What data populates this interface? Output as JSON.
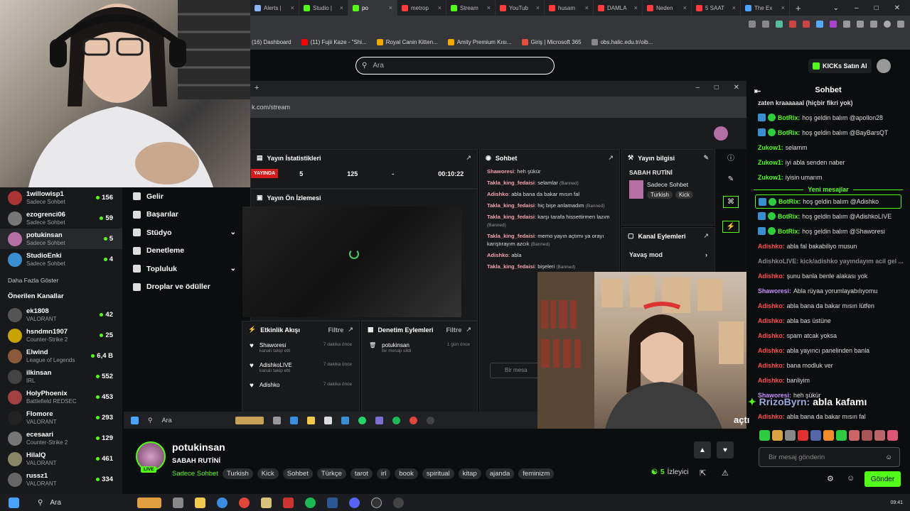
{
  "browser": {
    "tabs": [
      {
        "label": "Alerts | ",
        "color": "#8ab4f8"
      },
      {
        "label": "Studio | ",
        "color": "#53fc18"
      },
      {
        "label": "po",
        "color": "#53fc18",
        "active": true
      },
      {
        "label": "metrop",
        "color": "#ff3b3b"
      },
      {
        "label": "Stream",
        "color": "#53fc18"
      },
      {
        "label": "YouTub",
        "color": "#ff3b3b"
      },
      {
        "label": "husam",
        "color": "#ff3b3b"
      },
      {
        "label": "DAMLA",
        "color": "#ff3b3b"
      },
      {
        "label": "Neden",
        "color": "#ff3b3b"
      },
      {
        "label": "5 SAAT",
        "color": "#ff3b3b"
      },
      {
        "label": "The Ex",
        "color": "#4aa3ff"
      }
    ],
    "new_tab": "+",
    "bookmarks": [
      {
        "label": "(16) Dashboard",
        "color": "#444"
      },
      {
        "label": "(11) Fujii Kaze - \"Shi...",
        "color": "#ff0000"
      },
      {
        "label": "Royal Canin Kitten...",
        "color": "#f2a900"
      },
      {
        "label": "Amity Premium Kısı...",
        "color": "#f2a900"
      },
      {
        "label": "Giriş | Microsoft 365",
        "color": "#e74c3c"
      },
      {
        "label": "obs.halic.edu.tr/oib...",
        "color": "#888"
      }
    ]
  },
  "header": {
    "search_placeholder": "Ara",
    "kicks_button": "KICKs Satın Al"
  },
  "sidebar": {
    "followed": [
      {
        "name": "1willowisp1",
        "sub": "Sadece Sohbet",
        "viewers": "156",
        "color": "#a33"
      },
      {
        "name": "ezogrenci06",
        "sub": "Sadece Sohbet",
        "viewers": "59",
        "color": "#777"
      },
      {
        "name": "potukinsan",
        "sub": "Sadece Sohbet",
        "viewers": "5",
        "color": "#b56fa5"
      },
      {
        "name": "StudioEnki",
        "sub": "Sadece Sohbet",
        "viewers": "4",
        "color": "#3a8fd0"
      }
    ],
    "show_more": "Daha Fazla Göster",
    "recommended_title": "Önerilen Kanallar",
    "recommended": [
      {
        "name": "ek1808",
        "sub": "VALORANT",
        "viewers": "42",
        "color": "#555"
      },
      {
        "name": "hsndmn1907",
        "sub": "Counter-Strike 2",
        "viewers": "25",
        "color": "#c9a400"
      },
      {
        "name": "Elwind",
        "sub": "League of Legends",
        "viewers": "6,4 B",
        "color": "#8a5a3a"
      },
      {
        "name": "ilkinsan",
        "sub": "IRL",
        "viewers": "552",
        "color": "#444"
      },
      {
        "name": "HolyPhoenix",
        "sub": "Battlefield REDSEC",
        "viewers": "453",
        "color": "#a04040"
      },
      {
        "name": "Flomore",
        "sub": "VALORANT",
        "viewers": "293",
        "color": "#222"
      },
      {
        "name": "ecesaari",
        "sub": "Counter-Strike 2",
        "viewers": "129",
        "color": "#777"
      },
      {
        "name": "HilalQ",
        "sub": "VALORANT",
        "viewers": "461",
        "color": "#886"
      },
      {
        "name": "russz1",
        "sub": "VALORANT",
        "viewers": "334",
        "color": "#666"
      }
    ]
  },
  "nav": {
    "items": [
      "Gelir",
      "Başarılar",
      "Stüdyo",
      "Denetleme",
      "Topluluk",
      "Droplar ve ödüller"
    ]
  },
  "share": {
    "url": "k.com/stream",
    "stats_title": "Yayın İstatistikleri",
    "live_label": "YAYINDA",
    "stat1": "5",
    "stat2": "125",
    "stat3": "-",
    "stat4": "00:10:22",
    "preview_title": "Yayın Ön İzlemesi",
    "chat_title": "Sohbet",
    "chat_lines": [
      {
        "user": "Shaworesi",
        "text": "heh şükür",
        "note": ""
      },
      {
        "user": "Takla_king_fedaisi",
        "text": "selamlar",
        "note": "(Banned)"
      },
      {
        "user": "Adishko",
        "text": "abla bana da bakar mısın fal",
        "note": ""
      },
      {
        "user": "Takla_king_fedaisi",
        "text": "hiç bişe anlamadım",
        "note": "(Banned)"
      },
      {
        "user": "Takla_king_fedaisi",
        "text": "karşı tarafa hissettirmen lazım",
        "note": "(Banned)"
      },
      {
        "user": "Takla_king_fedaisi",
        "text": "memo yayın açtımı ya orayı karıştırayım azcık",
        "note": "(Banned)"
      },
      {
        "user": "Adishko",
        "text": "abla",
        "note": ""
      },
      {
        "user": "Takla_king_fedaisi",
        "text": "bişeleri",
        "note": "(Banned)"
      }
    ],
    "info_title": "Yayın bilgisi",
    "info_stream_title": "SABAH RUTİNİ",
    "info_category": "Sadece Sohbet",
    "info_tags": [
      "Turkish",
      "Kick"
    ],
    "channel_actions_title": "Kanal Eylemleri",
    "slow_mode": "Yavaş mod",
    "activity_title": "Etkinlik Akışı",
    "filter": "Filtre",
    "events": [
      {
        "user": "Shaworesi",
        "action": "kanalı takip etti",
        "time": "7 dakika önce"
      },
      {
        "user": "AdishkoLIVE",
        "action": "kanalı takip etti",
        "time": "7 dakika önce"
      },
      {
        "user": "Adishko",
        "action": "",
        "time": "7 dakika önce"
      }
    ],
    "mod_title": "Denetim Eylemleri",
    "mod_event": {
      "user": "potukinsan",
      "action": "bir mesajı sildi",
      "time": "1 gün önce"
    },
    "mini_input": "Bir mesa",
    "taskbar_search": "Ara"
  },
  "chat": {
    "title": "Sohbet",
    "messages": [
      {
        "user": "zaten kraaaaaal (hiçbir fikri yok)",
        "text": "",
        "color": "#ddd",
        "bot": false,
        "hl": false
      },
      {
        "user": "BotRix:",
        "text": "hoş geldin balım @apollon28",
        "color": "#53fc18",
        "bot": true,
        "hl": false
      },
      {
        "user": "BotRix:",
        "text": "hoş geldin balım @BayBarsQT",
        "color": "#53fc18",
        "bot": true,
        "hl": false
      },
      {
        "user": "Zukow1:",
        "text": "selamm",
        "color": "#53fc18",
        "bot": false,
        "hl": false
      },
      {
        "user": "Zukow1:",
        "text": "iyi abla senden naber",
        "color": "#53fc18",
        "bot": false,
        "hl": false
      },
      {
        "user": "Zukow1:",
        "text": "iyisin umarım",
        "color": "#53fc18",
        "bot": false,
        "hl": false
      }
    ],
    "new_messages": "Yeni mesajlar",
    "messages2": [
      {
        "user": "BotRix:",
        "text": "hoş geldin balım @Adishko",
        "color": "#53fc18",
        "bot": true,
        "hl": true
      },
      {
        "user": "BotRix:",
        "text": "hoş geldin balım @AdishkoLIVE",
        "color": "#53fc18",
        "bot": true,
        "hl": false
      },
      {
        "user": "BotRix:",
        "text": "hoş geldin balım @Shaworesi",
        "color": "#53fc18",
        "bot": true,
        "hl": false
      },
      {
        "user": "Adishko:",
        "text": "abla fal bakabiliyo musun",
        "color": "#ff4d4d",
        "bot": false,
        "hl": false
      },
      {
        "user": "AdishkoLIVE: kick/adishko yayındayım acil gel ...",
        "text": "",
        "color": "#888",
        "bot": false,
        "hl": false
      },
      {
        "user": "Adishko:",
        "text": "şunu banla benle alakası yok",
        "color": "#ff4d4d",
        "bot": false,
        "hl": false
      },
      {
        "user": "Shaworesi:",
        "text": "Abla rüyaa yorumlayabılıyomu",
        "color": "#c98cff",
        "bot": false,
        "hl": false
      },
      {
        "user": "Adishko:",
        "text": "abla bana da bakar mısın lütfen",
        "color": "#ff4d4d",
        "bot": false,
        "hl": false
      },
      {
        "user": "Adishko:",
        "text": "abla bas üstüne",
        "color": "#ff4d4d",
        "bot": false,
        "hl": false
      },
      {
        "user": "Adishko:",
        "text": "spam atcak yoksa",
        "color": "#ff4d4d",
        "bot": false,
        "hl": false
      },
      {
        "user": "Adishko:",
        "text": "abla yayıncı panelinden banla",
        "color": "#ff4d4d",
        "bot": false,
        "hl": false
      },
      {
        "user": "Adishko:",
        "text": "bana modluk ver",
        "color": "#ff4d4d",
        "bot": false,
        "hl": false
      },
      {
        "user": "Adishko:",
        "text": "banliyim",
        "color": "#ff4d4d",
        "bot": false,
        "hl": false
      },
      {
        "user": "Shaworesi:",
        "text": "heh şükür",
        "color": "#c98cff",
        "bot": false,
        "hl": false
      },
      {
        "user": "",
        "text": "",
        "color": "#ddd",
        "bot": false,
        "hl": false
      },
      {
        "user": "Adishko:",
        "text": "abla bana da bakar mısın fal",
        "color": "#ff4d4d",
        "bot": false,
        "hl": false
      }
    ],
    "alert_user": "RrizoByrn:",
    "alert_text": "abla kafamı",
    "alert_text2": "açtı",
    "input_placeholder": "Bir mesaj gönderin",
    "send": "Gönder"
  },
  "stream": {
    "name": "potukinsan",
    "title": "SABAH RUTİNİ",
    "live": "LIVE",
    "category": "Sadece Sohbet",
    "tags": [
      "Turkish",
      "Kick",
      "Sohbet",
      "Türkçe",
      "tarot",
      "irl",
      "book",
      "spiritual",
      "kitap",
      "ajanda",
      "feminizm"
    ],
    "viewers": "5",
    "viewers_label": "İzleyici"
  },
  "taskbar": {
    "search": "Ara",
    "time": "09:41"
  }
}
